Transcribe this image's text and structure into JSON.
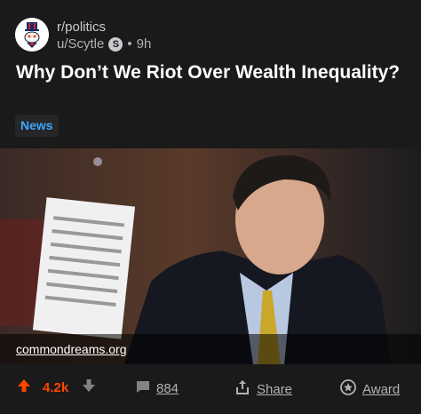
{
  "post": {
    "subreddit": "r/politics",
    "author": "u/Scytle",
    "author_badge": "S",
    "separator": "•",
    "time": "9h",
    "title": "Why Don’t We Riot Over Wealth Inequality?",
    "flair": "News",
    "link_domain": "commondreams.org"
  },
  "actions": {
    "upvote_icon": "arrow-up-icon",
    "score": "4.2k",
    "downvote_icon": "arrow-down-icon",
    "comments_icon": "comment-icon",
    "comments": "884",
    "share_icon": "share-icon",
    "share": "Share",
    "award_icon": "award-icon",
    "award": "Award"
  },
  "colors": {
    "background": "#1a1a1b",
    "upvote": "#ff4500",
    "flair_text": "#3ea6ff",
    "text_primary": "#ffffff",
    "text_secondary": "#b0b3b6"
  }
}
